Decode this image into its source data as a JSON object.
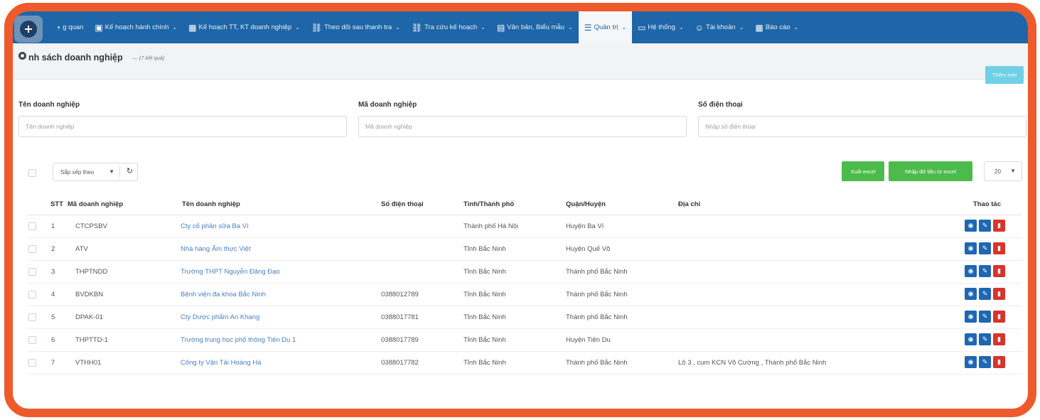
{
  "navbar": {
    "items": [
      {
        "label": "g quan",
        "icon": "dashboard-icon",
        "active": false,
        "caret": false
      },
      {
        "label": "Kế hoạch hành chính",
        "icon": "briefcase-icon",
        "active": false,
        "caret": true
      },
      {
        "label": "Kế hoạch TT, KT doanh nghiệp",
        "icon": "calendar-icon",
        "active": false,
        "caret": true
      },
      {
        "label": "Theo dõi sau thanh tra",
        "icon": "binoculars-icon",
        "active": false,
        "caret": true
      },
      {
        "label": "Tra cứu kế hoạch",
        "icon": "binoculars-icon",
        "active": false,
        "caret": true
      },
      {
        "label": "Văn bản, Biểu mẫu",
        "icon": "document-icon",
        "active": false,
        "caret": true
      },
      {
        "label": "Quản trị",
        "icon": "sliders-icon",
        "active": true,
        "caret": true
      },
      {
        "label": "Hệ thống",
        "icon": "monitor-icon",
        "active": false,
        "caret": true
      },
      {
        "label": "Tài khoản",
        "icon": "user-icon",
        "active": false,
        "caret": true
      },
      {
        "label": "Báo cáo",
        "icon": "table-icon",
        "active": false,
        "caret": true
      }
    ]
  },
  "page": {
    "title": "nh sách doanh nghiệp",
    "result_count": "— (7 kết quả)",
    "add_button": "Thêm mới"
  },
  "filters": {
    "name_label": "Tên doanh nghiệp",
    "name_placeholder": "Tên doanh nghiệp",
    "code_label": "Mã doanh nghiệp",
    "code_placeholder": "Mã doanh nghiệp",
    "phone_label": "Số điện thoại",
    "phone_placeholder": "Nhập số điện thoại"
  },
  "toolbar": {
    "sort_label": "Sắp xếp theo",
    "export_excel": "Xuất excel",
    "import_excel": "Nhập dữ liệu từ excel",
    "page_size": "20"
  },
  "table": {
    "headers": {
      "stt": "STT",
      "code": "Mã doanh nghiệp",
      "name": "Tên doanh nghiệp",
      "phone": "Số điện thoại",
      "province": "Tỉnh/Thành phố",
      "district": "Quận/Huyện",
      "address": "Địa chỉ",
      "actions": "Thao tác"
    },
    "rows": [
      {
        "stt": "1",
        "code": "CTCPSBV",
        "name": "Cty cổ phần sữa Ba Vì",
        "phone": "",
        "province": "Thành phố Hà Nội",
        "district": "Huyện Ba Vì",
        "address": ""
      },
      {
        "stt": "2",
        "code": "ATV",
        "name": "Nhà hàng Ẩm thực Việt",
        "phone": "",
        "province": "Tỉnh Bắc Ninh",
        "district": "Huyện Quế Võ",
        "address": ""
      },
      {
        "stt": "3",
        "code": "THPTNDD",
        "name": "Trường THPT Nguyễn Đăng Đạo",
        "phone": "",
        "province": "Tỉnh Bắc Ninh",
        "district": "Thành phố Bắc Ninh",
        "address": ""
      },
      {
        "stt": "4",
        "code": "BVDKBN",
        "name": "Bệnh viện đa khoa Bắc Ninh",
        "phone": "0388012789",
        "province": "Tỉnh Bắc Ninh",
        "district": "Thành phố Bắc Ninh",
        "address": ""
      },
      {
        "stt": "5",
        "code": "DPAK-01",
        "name": "Cty Dược phẩm An Khang",
        "phone": "0388017781",
        "province": "Tỉnh Bắc Ninh",
        "district": "Thành phố Bắc Ninh",
        "address": ""
      },
      {
        "stt": "6",
        "code": "THPTTD-1",
        "name": "Trường trung học phổ thông Tiên Du 1",
        "phone": "0388017789",
        "province": "Tỉnh Bắc Ninh",
        "district": "Huyện Tiên Du",
        "address": ""
      },
      {
        "stt": "7",
        "code": "VTHH01",
        "name": "Công ty Vận Tải Hoàng Hà",
        "phone": "0388017782",
        "province": "Tỉnh Bắc Ninh",
        "district": "Thành phố Bắc Ninh",
        "address": "Lô 3 , cụm KCN Võ Cường , Thành phố Bắc Ninh"
      }
    ]
  },
  "colors": {
    "frame": "#ee5a2b",
    "navbar": "#1e66a8",
    "link": "#4a7fc2",
    "green": "#4cbb4c",
    "danger": "#d9342b"
  }
}
